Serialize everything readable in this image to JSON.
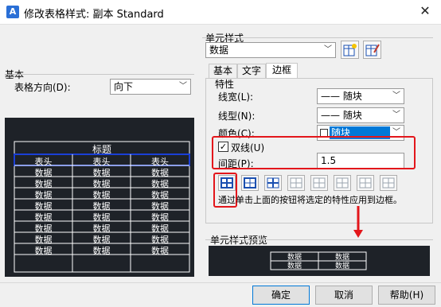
{
  "window": {
    "title": "修改表格样式: 副本 Standard",
    "close": "✕"
  },
  "left": {
    "basic_group_label": "基本",
    "direction_label": "表格方向(D):",
    "direction_value": "向下",
    "preview_title": "标题",
    "preview_header": [
      "表头",
      "表头",
      "表头"
    ],
    "preview_row": [
      "数据",
      "数据",
      "数据"
    ],
    "preview_row_count": 8
  },
  "right": {
    "cell_style_group_label": "单元样式",
    "cell_style_value": "数据",
    "tabs": [
      "基本",
      "文字",
      "边框"
    ],
    "properties_label": "特性",
    "line_width_label": "线宽(L):",
    "line_width_value": "—— 随块",
    "line_type_label": "线型(N):",
    "line_type_value": "—— 随块",
    "color_label": "颜色(C):",
    "color_value": "随块",
    "double_line_label": "双线(U)",
    "double_line_checked": true,
    "spacing_label": "间距(P):",
    "spacing_value": "1.5",
    "border_hint": "通过单击上面的按钮将选定的特性应用到边框。",
    "cell_preview_label": "单元样式预览",
    "cell_preview_text": [
      "数据",
      "数据",
      "数据",
      "数据"
    ]
  },
  "buttons": {
    "ok": "确定",
    "cancel": "取消",
    "help": "帮助(H)"
  },
  "colors": {
    "accent": "#0078d7",
    "highlight_red": "#e3161b",
    "preview_bg": "#1e2228",
    "header_blue": "#1a3fd6"
  }
}
